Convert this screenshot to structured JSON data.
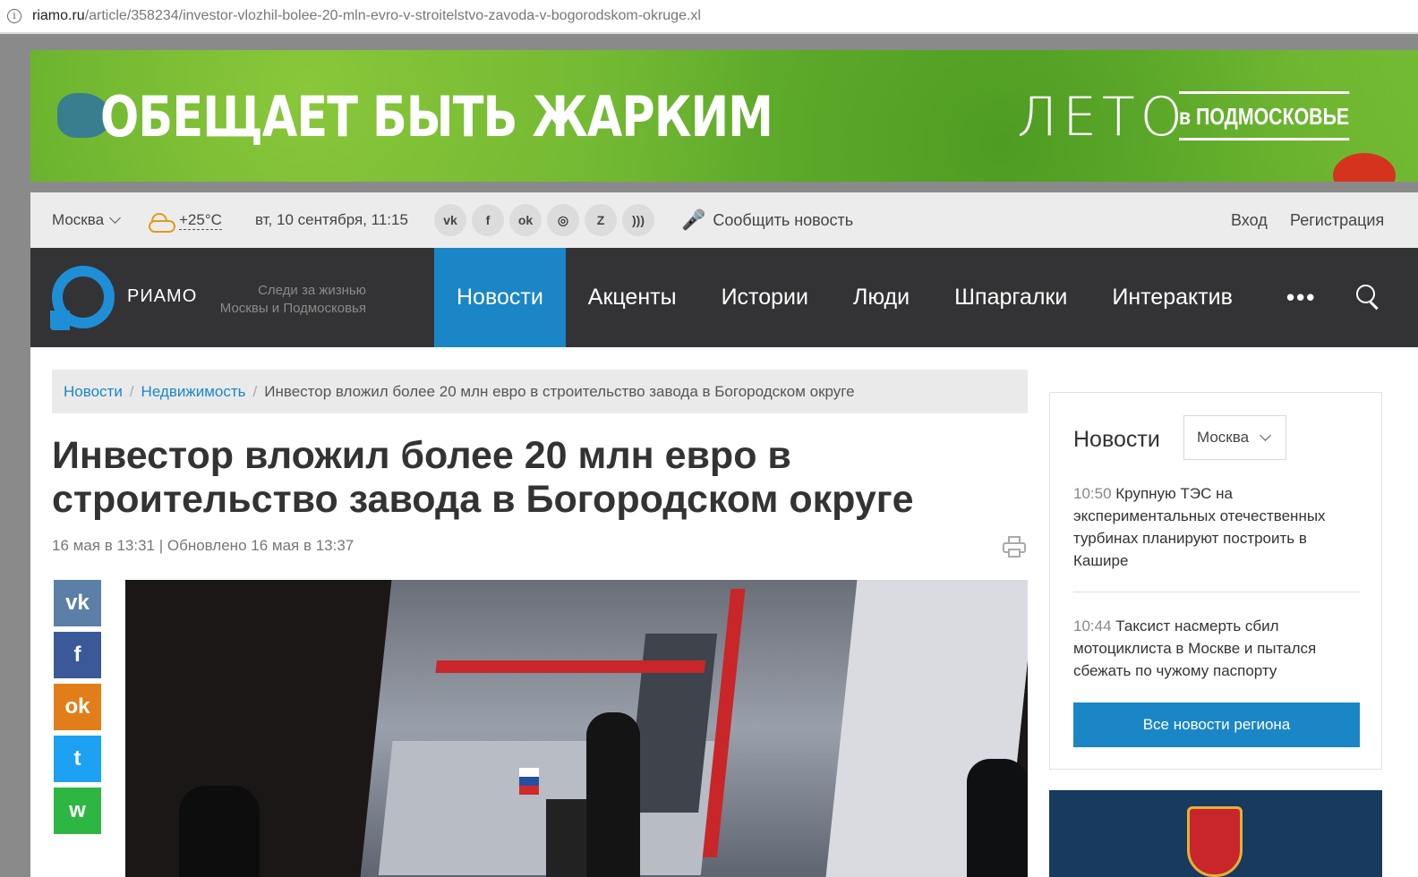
{
  "browser": {
    "url_host": "riamo.ru",
    "url_path": "/article/358234/investor-vlozhil-bolee-20-mln-evro-v-stroitelstvo-zavoda-v-bogorodskom-okruge.xl"
  },
  "banner": {
    "slogan": "ОБЕЩАЕТ БЫТЬ ЖАРКИМ",
    "brand_big": "ЛЕТО",
    "brand_small": "в ПОДМОСКОВЬЕ"
  },
  "topbar": {
    "city": "Москва",
    "temperature": "+25°C",
    "date": "вт, 10 сентября, 11:15",
    "socials": [
      {
        "icon": "vk-icon",
        "glyph": "vk"
      },
      {
        "icon": "facebook-icon",
        "glyph": "f"
      },
      {
        "icon": "odnoklassniki-icon",
        "glyph": "ok"
      },
      {
        "icon": "instagram-icon",
        "glyph": "◎"
      },
      {
        "icon": "zen-icon",
        "glyph": "Z"
      },
      {
        "icon": "rss-icon",
        "glyph": ")))"
      }
    ],
    "report_news": "Сообщить новость",
    "login": "Вход",
    "register": "Регистрация"
  },
  "nav": {
    "brand": "РИАМО",
    "tagline": "Следи за жизнью Москвы и Подмосковья",
    "items": [
      "Новости",
      "Акценты",
      "Истории",
      "Люди",
      "Шпаргалки",
      "Интерактив"
    ],
    "active_index": 0,
    "more": "•••",
    "accent_color": "#1b86c6"
  },
  "article": {
    "breadcrumb": [
      "Новости",
      "Недвижимость",
      "Инвестор вложил более 20 млн евро в строительство завода в Богородском округе"
    ],
    "title": "Инвестор вложил более 20 млн евро в строительство завода в Богородском округе",
    "meta": "16 мая в 13:31 | Обновлено 16 мая в 13:37",
    "share_buttons": [
      {
        "icon": "vk-icon",
        "glyph": "vk",
        "color": "#5b7fa6"
      },
      {
        "icon": "facebook-icon",
        "glyph": "f",
        "color": "#3b5998"
      },
      {
        "icon": "odnoklassniki-icon",
        "glyph": "ok",
        "color": "#e27e19"
      },
      {
        "icon": "twitter-icon",
        "glyph": "t",
        "color": "#1da1f2"
      },
      {
        "icon": "whatsapp-icon",
        "glyph": "w",
        "color": "#2db742"
      }
    ]
  },
  "sidebar": {
    "header": "Новости",
    "region": "Москва",
    "news": [
      {
        "time": "10:50",
        "text": "Крупную ТЭС на экспериментальных отечественных турбинах планируют построить в Кашире"
      },
      {
        "time": "10:44",
        "text": "Таксист насмерть сбил мотоциклиста в Москве и пытался сбежать по чужому паспорту"
      }
    ],
    "all_news_button": "Все новости региона"
  }
}
